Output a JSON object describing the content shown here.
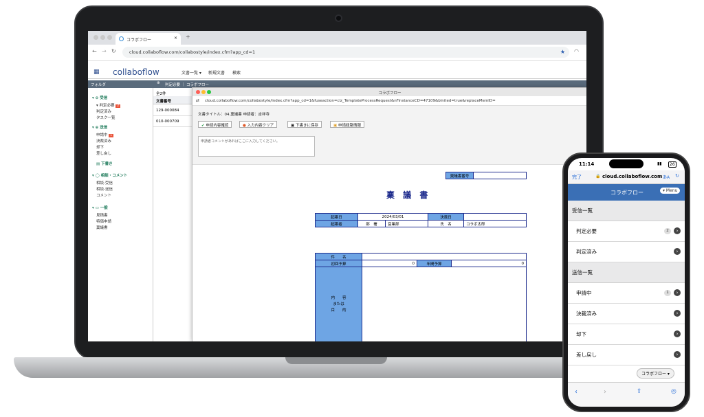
{
  "laptop": {
    "browser": {
      "tab_title": "コラボフロー",
      "tab_add": "+",
      "url": "cloud.collaboflow.com/collabostyle/index.cfm?app_cd=1"
    },
    "app": {
      "logo": "collaboflow",
      "menu": [
        "文書一覧 ▾",
        "新規文書",
        "検索"
      ],
      "folder_label": "フォルダ",
      "breadcrumb": "判定必要 ｜ コラボフロー"
    },
    "sidebar": {
      "received": {
        "title": "受信",
        "items": [
          "判定必要",
          "判定済み",
          "タスク一覧"
        ],
        "badge": "2"
      },
      "sent": {
        "title": "送信",
        "items": [
          "申請中",
          "決裁済み",
          "却下",
          "差し戻し"
        ],
        "badge": "1"
      },
      "drafts": {
        "title": "下書き"
      },
      "consult": {
        "title": "相談・コメント",
        "items": [
          "相談-受信",
          "相談-送信",
          "コメント"
        ]
      },
      "general": {
        "title": "一般",
        "items": [
          "見積書",
          "特価申請",
          "稟議書"
        ]
      }
    },
    "list": {
      "count": "全2件",
      "header": "文書番号",
      "rows": [
        "129-000084",
        "010-000709"
      ]
    },
    "modal": {
      "title": "コラボフロー",
      "url": "cloud.collaboflow.com/collabostyle/index.cfm?app_cd=1&fuseaction=clz_TemplateProcessRequest&nFinstanceCD=47109&blnited=true&replaceMemID=",
      "doc_title": "文書タイトル：04.稟議書 申請者：吉祥寺",
      "buttons": [
        "申請内容確認",
        "入力内容クリア",
        "下書きに保存",
        "申請経路情報"
      ],
      "comment_placeholder": "申請者コメントがあればここに入力してください。",
      "form": {
        "doc_no_label": "稟議書番号",
        "heading": "稟 議 書",
        "draft_date_label": "起案日",
        "draft_date": "2024/03/01",
        "decision_date_label": "決裁日",
        "drafter_label": "起案者",
        "dept_label": "部　署",
        "dept": "営業部",
        "name_label": "氏　名",
        "name": "コラボ太郎",
        "subject_label": "件　　名",
        "initial_budget_label": "初回予算",
        "initial_budget": "0",
        "annual_budget_label": "年間予算",
        "annual_budget": "0",
        "content_label_1": "内　　容",
        "content_label_2": "または",
        "content_label_3": "目　　的"
      }
    }
  },
  "phone": {
    "status": {
      "time": "11:14",
      "battery": "26"
    },
    "back": "完了",
    "url": "cloud.collaboflow.com",
    "aa": "あA",
    "title": "コラボフロー",
    "menu": "Menu",
    "sections": [
      {
        "title": "受信一覧",
        "rows": [
          {
            "label": "判定必要",
            "count": "2"
          },
          {
            "label": "判定済み",
            "count": ""
          }
        ]
      },
      {
        "title": "送信一覧",
        "rows": [
          {
            "label": "申請中",
            "count": "1"
          },
          {
            "label": "決裁済み",
            "count": ""
          },
          {
            "label": "却下",
            "count": ""
          },
          {
            "label": "差し戻し",
            "count": ""
          }
        ]
      }
    ],
    "footer_button": "コラボフロー"
  }
}
